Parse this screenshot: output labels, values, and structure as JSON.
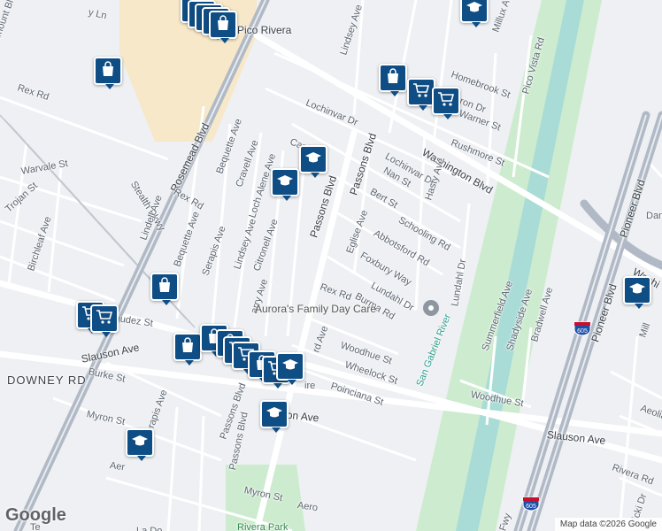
{
  "attribution": {
    "logo": "Google",
    "copyright": "Map data ©2026 Google"
  },
  "colors": {
    "pin": "#0f4d85",
    "water": "#a9dcd6",
    "green": "#cdeccf",
    "commercial": "#f6e8c8",
    "road": "#ffffff",
    "highway": "#b0b9c5"
  },
  "poi": {
    "name": "Aurora's Family Day Care",
    "icon": "place-icon"
  },
  "streets": [
    {
      "id": "rosemead",
      "text": "Rosemead Blvd",
      "cls": "hw"
    },
    {
      "id": "washington",
      "text": "Washington Blvd",
      "cls": "hw"
    },
    {
      "id": "washington2",
      "text": "Washi",
      "cls": "hw"
    },
    {
      "id": "slauson-left",
      "text": "Slauson Ave",
      "cls": "hw"
    },
    {
      "id": "slauson-mid",
      "text": "son Ave",
      "cls": "hw"
    },
    {
      "id": "slauson-right",
      "text": "Slauson Ave",
      "cls": "hw"
    },
    {
      "id": "pioneer",
      "text": "Pioneer Blvd",
      "cls": "hw"
    },
    {
      "id": "pioneer2",
      "text": "Pioneer Blvd",
      "cls": "hw"
    },
    {
      "id": "downey",
      "text": "DOWNEY RD",
      "cls": "big"
    },
    {
      "id": "passons1",
      "text": "Passons Blvd",
      "cls": "hw"
    },
    {
      "id": "passons2",
      "text": "Passons Blvd",
      "cls": "hw"
    },
    {
      "id": "passons3",
      "text": "Passons Blvd",
      "cls": ""
    },
    {
      "id": "pico",
      "text": "Pico Rivera",
      "cls": "hw"
    },
    {
      "id": "paramount",
      "text": "aramount Blvd",
      "cls": ""
    },
    {
      "id": "rexw",
      "text": "Rex Rd",
      "cls": ""
    },
    {
      "id": "stealth",
      "text": "Stealth Pkwy",
      "cls": ""
    },
    {
      "id": "lochinvar",
      "text": "Lochinvar Dr",
      "cls": ""
    },
    {
      "id": "lochinvar2",
      "text": "Lochinvar Dr",
      "cls": ""
    },
    {
      "id": "lindsey-top",
      "text": "Lindsey Ave",
      "cls": ""
    },
    {
      "id": "homebrook",
      "text": "Homebrook St",
      "cls": ""
    },
    {
      "id": "carron",
      "text": "Carron Dr",
      "cls": ""
    },
    {
      "id": "warner",
      "text": "Warner St",
      "cls": ""
    },
    {
      "id": "rushmore",
      "text": "Rushmore St",
      "cls": ""
    },
    {
      "id": "millux",
      "text": "Millux Ave",
      "cls": ""
    },
    {
      "id": "picovista",
      "text": "Pico Vista Rd",
      "cls": ""
    },
    {
      "id": "bequette1",
      "text": "Bequette Ave",
      "cls": ""
    },
    {
      "id": "bequette2",
      "text": "Bequette Ave",
      "cls": ""
    },
    {
      "id": "cravell",
      "text": "Cravell Ave",
      "cls": ""
    },
    {
      "id": "lochalene",
      "text": "Loch Alene Ave",
      "cls": ""
    },
    {
      "id": "canf",
      "text": "Canf",
      "cls": ""
    },
    {
      "id": "nan",
      "text": "Nan St",
      "cls": ""
    },
    {
      "id": "bert",
      "text": "Bert St",
      "cls": ""
    },
    {
      "id": "hasty",
      "text": "Hasty Ave",
      "cls": ""
    },
    {
      "id": "schooling",
      "text": "Schooling Rd",
      "cls": ""
    },
    {
      "id": "abbotsford",
      "text": "Abbotsford Rd",
      "cls": ""
    },
    {
      "id": "eglise",
      "text": "Eglise Ave",
      "cls": ""
    },
    {
      "id": "foxbury",
      "text": "Foxbury Way",
      "cls": ""
    },
    {
      "id": "lundahl",
      "text": "Lundahl Dr",
      "cls": ""
    },
    {
      "id": "lundahl2",
      "text": "Lundahl Dr",
      "cls": ""
    },
    {
      "id": "burma",
      "text": "Burma Rd",
      "cls": ""
    },
    {
      "id": "rexmid",
      "text": "Rex Rd",
      "cls": ""
    },
    {
      "id": "rex2",
      "text": "Rex Rd",
      "cls": ""
    },
    {
      "id": "warvale",
      "text": "Warvale St",
      "cls": ""
    },
    {
      "id": "trojan",
      "text": "Trojan St",
      "cls": ""
    },
    {
      "id": "birchleaf",
      "text": "Birchleaf Ave",
      "cls": ""
    },
    {
      "id": "lindell",
      "text": "Lindell Ave",
      "cls": ""
    },
    {
      "id": "serapis1",
      "text": "Serapis Ave",
      "cls": ""
    },
    {
      "id": "serapis2",
      "text": "Serapis Ave",
      "cls": ""
    },
    {
      "id": "lindsey2",
      "text": "Lindsey Ave",
      "cls": ""
    },
    {
      "id": "citronell",
      "text": "Citronell Ave",
      "cls": ""
    },
    {
      "id": "bermudez",
      "text": "ermudez St",
      "cls": ""
    },
    {
      "id": "arry",
      "text": "arry Ave",
      "cls": ""
    },
    {
      "id": "woodhue1",
      "text": "Woodhue St",
      "cls": ""
    },
    {
      "id": "wheelock",
      "text": "Wheelock St",
      "cls": ""
    },
    {
      "id": "poinciana",
      "text": "Poinciana St",
      "cls": ""
    },
    {
      "id": "rdave",
      "text": "rd Ave",
      "cls": ""
    },
    {
      "id": "ire",
      "text": "ire",
      "cls": ""
    },
    {
      "id": "woodhue2",
      "text": "Woodhue St",
      "cls": ""
    },
    {
      "id": "summerfield",
      "text": "Summerfield Ave",
      "cls": ""
    },
    {
      "id": "shadyside",
      "text": "Shadyside Ave",
      "cls": ""
    },
    {
      "id": "bradwell",
      "text": "Bradwell Ave",
      "cls": ""
    },
    {
      "id": "burke",
      "text": "Burke St",
      "cls": ""
    },
    {
      "id": "myron1",
      "text": "Myron St",
      "cls": ""
    },
    {
      "id": "myron2",
      "text": "Myron St",
      "cls": ""
    },
    {
      "id": "aero1",
      "text": "Aer",
      "cls": ""
    },
    {
      "id": "aero2",
      "text": "Aero",
      "cls": ""
    },
    {
      "id": "passons4",
      "text": "Passons Blvd",
      "cls": ""
    },
    {
      "id": "rivera",
      "text": "Rivera Rd",
      "cls": ""
    },
    {
      "id": "aeolian",
      "text": "Aeolia",
      "cls": ""
    },
    {
      "id": "danby",
      "text": "Danby Av",
      "cls": ""
    },
    {
      "id": "vicki",
      "text": "Vicki Dr",
      "cls": ""
    },
    {
      "id": "sanriver",
      "text": "San Gabriel River",
      "cls": "water"
    },
    {
      "id": "riverapark",
      "text": "Rivera Park",
      "cls": "park"
    },
    {
      "id": "ladoc",
      "text": "La Do",
      "cls": ""
    },
    {
      "id": "fwy",
      "text": "r Fwy",
      "cls": ""
    },
    {
      "id": "yln",
      "text": "y Ln",
      "cls": ""
    },
    {
      "id": "te",
      "text": "Te",
      "cls": ""
    },
    {
      "id": "mill",
      "text": "Mill",
      "cls": ""
    }
  ],
  "shields": [
    {
      "id": "i605a",
      "text": "605"
    },
    {
      "id": "i605b",
      "text": "605"
    }
  ],
  "markers": [
    {
      "kind": "shop"
    },
    {
      "kind": "shop"
    },
    {
      "kind": "shop"
    },
    {
      "kind": "shop"
    },
    {
      "kind": "shop"
    },
    {
      "kind": "school"
    },
    {
      "kind": "shop"
    },
    {
      "kind": "cart"
    },
    {
      "kind": "cart"
    },
    {
      "kind": "school"
    },
    {
      "kind": "school"
    },
    {
      "kind": "cart"
    },
    {
      "kind": "cart"
    },
    {
      "kind": "shop"
    },
    {
      "kind": "shop"
    },
    {
      "kind": "shop"
    },
    {
      "kind": "shop"
    },
    {
      "kind": "shop"
    },
    {
      "kind": "cart"
    },
    {
      "kind": "cart"
    },
    {
      "kind": "shop"
    },
    {
      "kind": "cart"
    },
    {
      "kind": "school"
    },
    {
      "kind": "school"
    },
    {
      "kind": "school"
    },
    {
      "kind": "school"
    }
  ]
}
